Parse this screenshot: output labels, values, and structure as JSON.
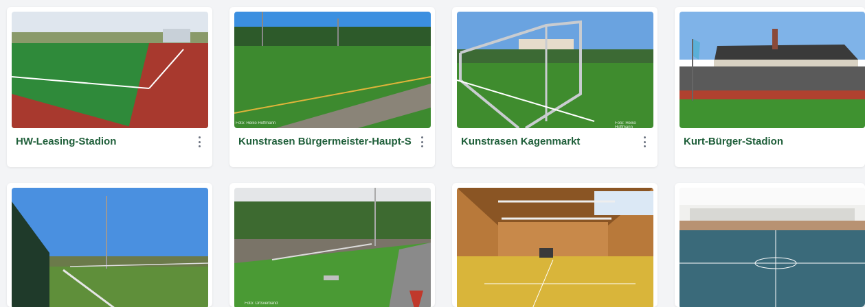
{
  "cards": [
    {
      "title": "HW-Leasing-Stadion",
      "image": "Kunstrasenplatz mit Laufbahn",
      "has_menu": true
    },
    {
      "title": "Kunstrasen Bürgermeister-Haupt-Straße",
      "image": "Kunstrasenplatz",
      "has_menu": true,
      "credit": "Foto: Heiko Hoffmann"
    },
    {
      "title": "Kunstrasen Kagenmarkt",
      "image": "Kunstrasen mit Fußballtor",
      "has_menu": true,
      "credit": "Foto: Heiko Hoffmann"
    },
    {
      "title": "Kurt-Bürger-Stadion",
      "image": "Stadion mit Tribüne",
      "has_menu": false
    },
    {
      "title": "",
      "image": "Sportplatz mit Geländer",
      "has_menu": false
    },
    {
      "title": "",
      "image": "Rasenplatz",
      "has_menu": false,
      "credit": "Foto: Ortsverband"
    },
    {
      "title": "",
      "image": "Sporthalle mit Holzverkleidung",
      "has_menu": false
    },
    {
      "title": "",
      "image": "Sporthalle blauer Boden",
      "has_menu": false
    }
  ],
  "colors": {
    "title": "#1f5f3a",
    "page_bg": "#f3f4f6",
    "card_bg": "#ffffff"
  },
  "icons": {
    "menu": "more-vertical-icon"
  }
}
